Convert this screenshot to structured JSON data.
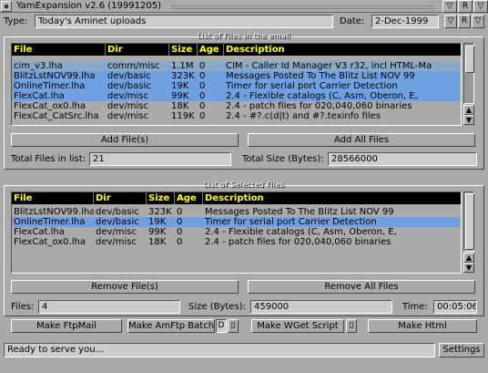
{
  "window": {
    "title": "YamExpansion v2.6 (19991205)",
    "buttons": [
      "▽",
      "R",
      "▽"
    ]
  },
  "type_row": {
    "type_label": "Type:",
    "type_value": "Today's Aminet uploads",
    "date_label": "Date:",
    "date_value": "2-Dec-1999"
  },
  "files_list": {
    "group_title": "List of Files in the email",
    "columns": [
      "File",
      "Dir",
      "Size",
      "Age",
      "Description"
    ],
    "rows": [
      {
        "file": "cim_v3.lha",
        "dir": "comm/misc",
        "size": "1.1M",
        "age": "0",
        "desc": "CIM - Caller Id Manager V3 r32, incl HTML-Ma"
      },
      {
        "file": "BlitzLstNOV99.lha",
        "dir": "dev/basic",
        "size": "323K",
        "age": "0",
        "desc": "Messages Posted To The Blitz List NOV 99"
      },
      {
        "file": "OnlineTimer.lha",
        "dir": "dev/basic",
        "size": "19K",
        "age": "0",
        "desc": "Timer for serial port Carrier Detection"
      },
      {
        "file": "FlexCat.lha",
        "dir": "dev/misc",
        "size": "99K",
        "age": "0",
        "desc": "2.4 - Flexible catalogs (C, Asm, Oberon, E,"
      },
      {
        "file": "FlexCat_ox0.lha",
        "dir": "dev/misc",
        "size": "18K",
        "age": "0",
        "desc": "2.4 - patch files for 020,040,060 binaries"
      },
      {
        "file": "FlexCat_CatSrc.lha",
        "dir": "dev/misc",
        "size": "119K",
        "age": "0",
        "desc": "2.4 - #?.c(d|t) and #?.texinfo files"
      }
    ],
    "add_files_label": "Add File(s)",
    "add_all_label": "Add All Files",
    "total_files_label": "Total Files in list:",
    "total_files_value": "21",
    "total_size_label": "Total Size (Bytes):",
    "total_size_value": "28566000"
  },
  "selected_list": {
    "group_title": "List of Selected Files",
    "columns": [
      "File",
      "Dir",
      "Size",
      "Age",
      "Description"
    ],
    "rows": [
      {
        "file": "BlitzLstNOV99.lha",
        "dir": "dev/basic",
        "size": "323K",
        "age": "0",
        "desc": "Messages Posted To The Blitz List NOV 99"
      },
      {
        "file": "OnlineTimer.lha",
        "dir": "dev/basic",
        "size": "19K",
        "age": "0",
        "desc": "Timer for serial port Carrier Detection"
      },
      {
        "file": "FlexCat.lha",
        "dir": "dev/misc",
        "size": "99K",
        "age": "0",
        "desc": "2.4 - Flexible catalogs (C, Asm, Oberon, E,"
      },
      {
        "file": "FlexCat_ox0.lha",
        "dir": "dev/misc",
        "size": "18K",
        "age": "0",
        "desc": "2.4 - patch files for 020,040,060 binaries"
      }
    ],
    "remove_files_label": "Remove File(s)",
    "remove_all_label": "Remove All Files",
    "files_label": "Files:",
    "files_value": "4",
    "size_label": "Size (Bytes):",
    "size_value": "459000",
    "time_label": "Time:",
    "time_value": "00:05:06"
  },
  "actions": {
    "ftpmail_label": "Make FtpMail",
    "amftp_label": "Make AmFtp Batch",
    "amftp_d": "D",
    "wget_label": "Make WGet Script",
    "html_label": "Make Html"
  },
  "status": {
    "text": "Ready to serve you...",
    "settings_label": "Settings"
  },
  "colors": {
    "selected_row": "#6fa0e0",
    "header_bg": "#000000",
    "header_text": "#ffff00",
    "window_bg": "#aaaaaa"
  }
}
